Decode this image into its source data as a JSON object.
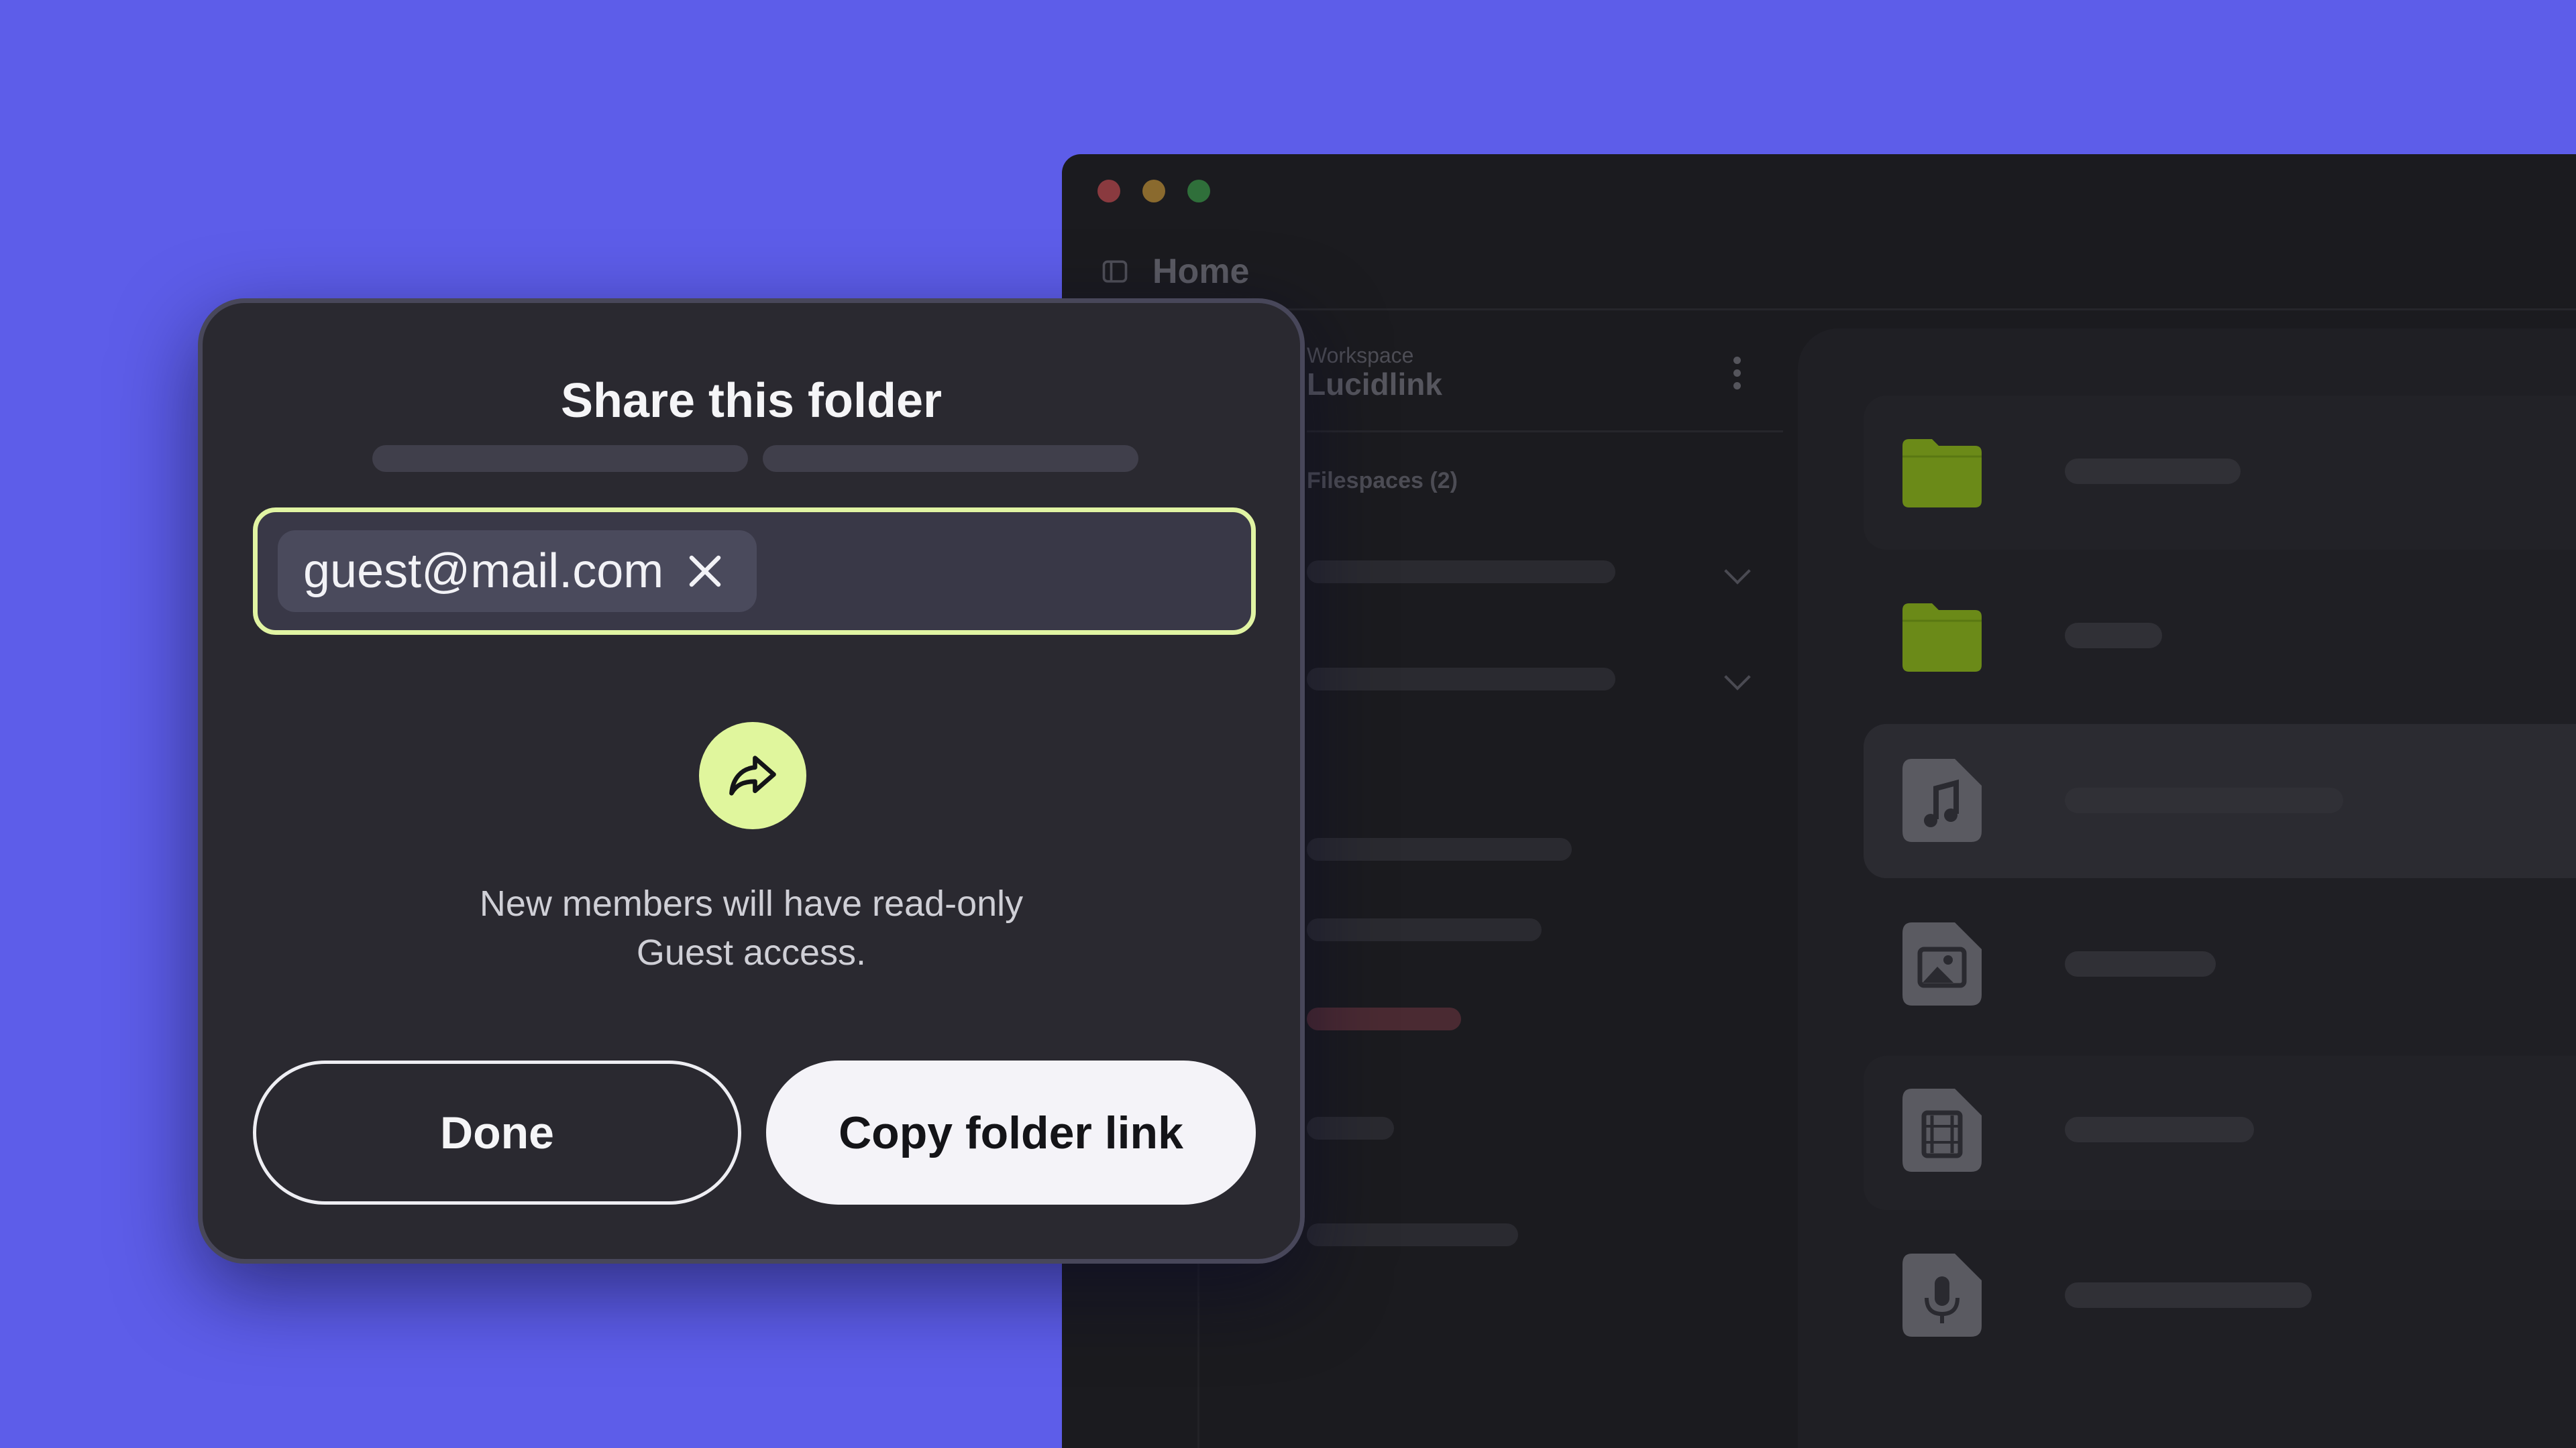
{
  "app": {
    "title": "Home",
    "workspace_label": "Workspace",
    "workspace_name": "Lucidlink",
    "section_label": "Filespaces (2)",
    "colors": {
      "background": "#5d5de9",
      "window": "#1b1b1f",
      "folder": "#6b8a18",
      "file_icon": "#5a5a61",
      "traffic_red": "#8a3a3f",
      "traffic_yellow": "#8a6a2e",
      "traffic_green": "#2f6f3a"
    },
    "file_icons": [
      "folder-icon",
      "folder-icon",
      "music-file-icon",
      "image-file-icon",
      "video-file-icon",
      "microphone-file-icon"
    ]
  },
  "modal": {
    "title": "Share this folder",
    "email_chip": "guest@mail.com",
    "message_line1": "New members will have read-only",
    "message_line2": "Guest access.",
    "done_label": "Done",
    "copy_label": "Copy folder link",
    "accent_color": "#e1f4a3"
  }
}
